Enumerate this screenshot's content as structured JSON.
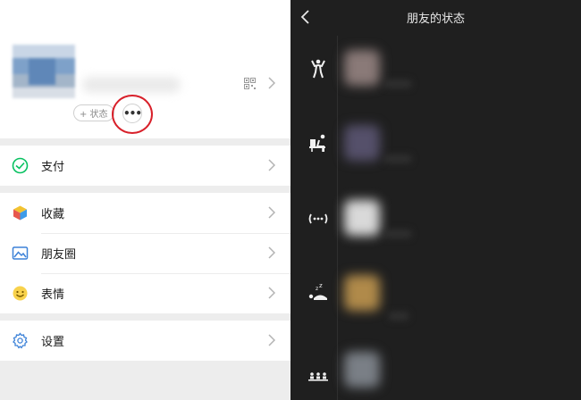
{
  "me": {
    "status_button_label": "+ 状态",
    "more_button_label": "•••"
  },
  "menu": {
    "pay": "支付",
    "favorites": "收藏",
    "moments": "朋友圈",
    "stickers": "表情",
    "settings": "设置"
  },
  "friend_status_page": {
    "title": "朋友的状态",
    "rows": [
      {
        "status_icon": "exercise-icon"
      },
      {
        "status_icon": "working-icon"
      },
      {
        "status_icon": "ellipsis-status-icon"
      },
      {
        "status_icon": "sleeping-icon"
      },
      {
        "status_icon": "group-icon"
      }
    ]
  },
  "colors": {
    "accent_green": "#07c160",
    "highlight_red": "#d8202a",
    "dark_bg": "#1f1f1f"
  }
}
